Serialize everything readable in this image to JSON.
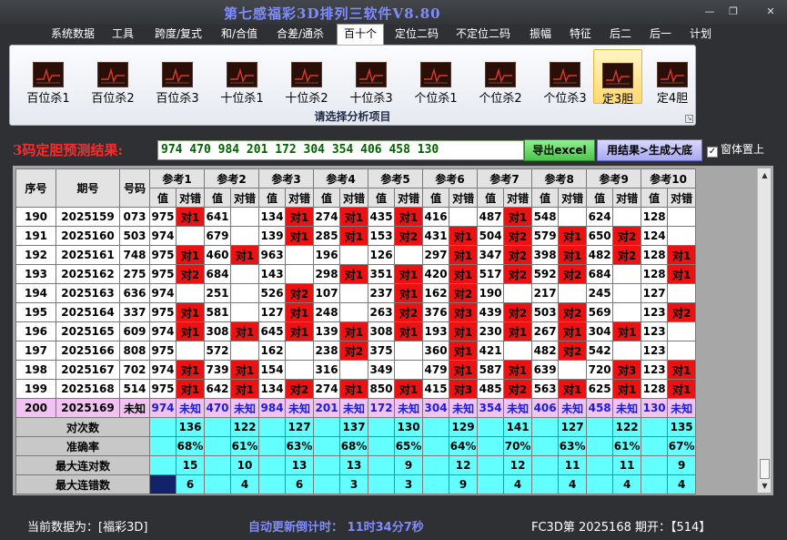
{
  "title": "第七感福彩3D排列三软件V8.80",
  "window_controls": {
    "minimize": "—",
    "restore": "❐",
    "close": "✕"
  },
  "menu": [
    "系统数据",
    "工具",
    "跨度/复式",
    "和/合值",
    "合差/通杀",
    "百十个",
    "定位二码",
    "不定位二码",
    "振幅",
    "特征",
    "后二",
    "后一",
    "计划"
  ],
  "active_menu": "百十个",
  "ribbon": {
    "tools": [
      "百位杀1",
      "百位杀2",
      "百位杀3",
      "十位杀1",
      "十位杀2",
      "十位杀3",
      "个位杀1",
      "个位杀2",
      "个位杀3",
      "定3胆",
      "定4胆"
    ],
    "active_tool": "定3胆",
    "caption": "请选择分析项目"
  },
  "result_label": "3码定胆预测结果:",
  "result_value": "974 470 984 201 172 304 354 406 458 130",
  "export_button": "导出excel",
  "generate_button": "用结果>生成大底",
  "topmost_checkbox": {
    "label": "窗体置上",
    "checked": true,
    "mark": "✓"
  },
  "table": {
    "head_seq": "序号",
    "head_issue": "期号",
    "head_num": "号码",
    "ref_names": [
      "参考1",
      "参考2",
      "参考3",
      "参考4",
      "参考5",
      "参考6",
      "参考7",
      "参考8",
      "参考9",
      "参考10"
    ],
    "sub_value": "值",
    "sub_result": "对错",
    "rows": [
      {
        "seq": "190",
        "issue": "2025159",
        "num": "073",
        "refs": [
          [
            "975",
            "对1"
          ],
          [
            "641",
            ""
          ],
          [
            "134",
            "对1"
          ],
          [
            "274",
            "对1"
          ],
          [
            "435",
            "对1"
          ],
          [
            "416",
            ""
          ],
          [
            "487",
            "对1"
          ],
          [
            "548",
            ""
          ],
          [
            "624",
            ""
          ],
          [
            "128",
            ""
          ]
        ]
      },
      {
        "seq": "191",
        "issue": "2025160",
        "num": "503",
        "refs": [
          [
            "974",
            ""
          ],
          [
            "679",
            ""
          ],
          [
            "139",
            "对1"
          ],
          [
            "285",
            "对1"
          ],
          [
            "153",
            "对2"
          ],
          [
            "431",
            "对1"
          ],
          [
            "504",
            "对2"
          ],
          [
            "579",
            "对1"
          ],
          [
            "650",
            "对2"
          ],
          [
            "124",
            ""
          ]
        ]
      },
      {
        "seq": "192",
        "issue": "2025161",
        "num": "748",
        "refs": [
          [
            "975",
            "对1"
          ],
          [
            "460",
            "对1"
          ],
          [
            "963",
            ""
          ],
          [
            "196",
            ""
          ],
          [
            "126",
            ""
          ],
          [
            "297",
            "对1"
          ],
          [
            "347",
            "对2"
          ],
          [
            "398",
            "对1"
          ],
          [
            "482",
            "对2"
          ],
          [
            "128",
            "对1"
          ]
        ]
      },
      {
        "seq": "193",
        "issue": "2025162",
        "num": "275",
        "refs": [
          [
            "975",
            "对2"
          ],
          [
            "684",
            ""
          ],
          [
            "143",
            ""
          ],
          [
            "298",
            "对1"
          ],
          [
            "351",
            "对1"
          ],
          [
            "420",
            "对1"
          ],
          [
            "517",
            "对2"
          ],
          [
            "592",
            "对2"
          ],
          [
            "684",
            ""
          ],
          [
            "128",
            "对1"
          ]
        ]
      },
      {
        "seq": "194",
        "issue": "2025163",
        "num": "636",
        "refs": [
          [
            "974",
            ""
          ],
          [
            "251",
            ""
          ],
          [
            "526",
            "对2"
          ],
          [
            "107",
            ""
          ],
          [
            "237",
            "对1"
          ],
          [
            "162",
            "对2"
          ],
          [
            "190",
            ""
          ],
          [
            "217",
            ""
          ],
          [
            "245",
            ""
          ],
          [
            "127",
            ""
          ]
        ]
      },
      {
        "seq": "195",
        "issue": "2025164",
        "num": "337",
        "refs": [
          [
            "975",
            "对1"
          ],
          [
            "581",
            ""
          ],
          [
            "127",
            "对1"
          ],
          [
            "248",
            ""
          ],
          [
            "263",
            "对2"
          ],
          [
            "376",
            "对3"
          ],
          [
            "439",
            "对2"
          ],
          [
            "503",
            "对2"
          ],
          [
            "569",
            ""
          ],
          [
            "123",
            "对2"
          ]
        ]
      },
      {
        "seq": "196",
        "issue": "2025165",
        "num": "609",
        "refs": [
          [
            "974",
            "对1"
          ],
          [
            "308",
            "对1"
          ],
          [
            "645",
            "对1"
          ],
          [
            "139",
            "对1"
          ],
          [
            "308",
            "对1"
          ],
          [
            "193",
            "对1"
          ],
          [
            "230",
            "对1"
          ],
          [
            "267",
            "对1"
          ],
          [
            "304",
            "对1"
          ],
          [
            "123",
            ""
          ]
        ]
      },
      {
        "seq": "197",
        "issue": "2025166",
        "num": "808",
        "refs": [
          [
            "975",
            ""
          ],
          [
            "572",
            ""
          ],
          [
            "162",
            ""
          ],
          [
            "238",
            "对2"
          ],
          [
            "375",
            ""
          ],
          [
            "360",
            "对1"
          ],
          [
            "421",
            ""
          ],
          [
            "482",
            "对2"
          ],
          [
            "542",
            ""
          ],
          [
            "123",
            ""
          ]
        ]
      },
      {
        "seq": "198",
        "issue": "2025167",
        "num": "702",
        "refs": [
          [
            "974",
            "对1"
          ],
          [
            "739",
            "对1"
          ],
          [
            "154",
            ""
          ],
          [
            "316",
            ""
          ],
          [
            "349",
            ""
          ],
          [
            "479",
            "对1"
          ],
          [
            "587",
            "对1"
          ],
          [
            "639",
            ""
          ],
          [
            "720",
            "对3"
          ],
          [
            "123",
            "对1"
          ]
        ]
      },
      {
        "seq": "199",
        "issue": "2025168",
        "num": "514",
        "refs": [
          [
            "975",
            "对1"
          ],
          [
            "642",
            "对1"
          ],
          [
            "134",
            "对2"
          ],
          [
            "274",
            "对1"
          ],
          [
            "850",
            "对1"
          ],
          [
            "415",
            "对3"
          ],
          [
            "485",
            "对2"
          ],
          [
            "563",
            "对1"
          ],
          [
            "625",
            "对1"
          ],
          [
            "128",
            "对1"
          ]
        ]
      }
    ],
    "pred_row": {
      "seq": "200",
      "issue": "2025169",
      "num": "未知",
      "values": [
        "974",
        "470",
        "984",
        "201",
        "172",
        "304",
        "354",
        "406",
        "458",
        "130"
      ],
      "unknown": "未知"
    },
    "stats": [
      {
        "label": "对次数",
        "values": [
          "136",
          "122",
          "127",
          "137",
          "130",
          "129",
          "141",
          "127",
          "122",
          "135"
        ]
      },
      {
        "label": "准确率",
        "values": [
          "68%",
          "61%",
          "63%",
          "68%",
          "65%",
          "64%",
          "70%",
          "63%",
          "61%",
          "67%"
        ]
      },
      {
        "label": "最大连对数",
        "values": [
          "15",
          "10",
          "13",
          "13",
          "9",
          "12",
          "12",
          "11",
          "11",
          "9"
        ]
      },
      {
        "label": "最大连错数",
        "values": [
          "6",
          "4",
          "6",
          "3",
          "3",
          "9",
          "4",
          "4",
          "4",
          "4"
        ]
      }
    ]
  },
  "status": {
    "current_data": "当前数据为：[福彩3D]",
    "countdown": "自动更新倒计时：  11时34分7秒",
    "draw_info": "FC3D第 2025168 期开：【514】"
  },
  "colors": {
    "hit": "#ee1111",
    "stat_bg": "#63ffff",
    "pred_bg": "#f1c3f1",
    "title": "#7f8cff",
    "result_label": "#ff2a2a"
  }
}
